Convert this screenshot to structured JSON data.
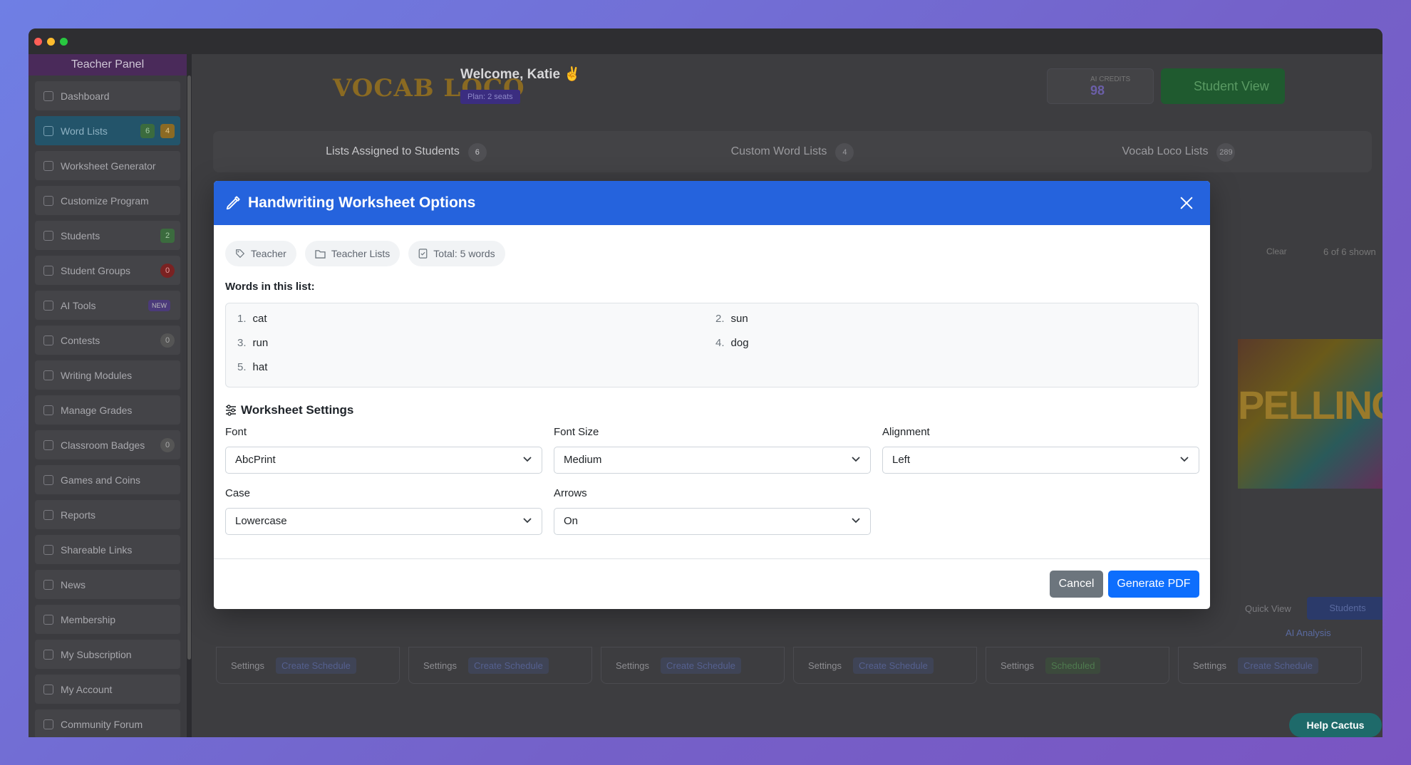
{
  "sidebar": {
    "title": "Teacher Panel",
    "items": [
      {
        "label": "Dashboard"
      },
      {
        "label": "Word Lists",
        "badges": [
          "6",
          "4"
        ]
      },
      {
        "label": "Worksheet Generator"
      },
      {
        "label": "Customize Program"
      },
      {
        "label": "Students",
        "badge": "2"
      },
      {
        "label": "Student Groups",
        "badge": "0"
      },
      {
        "label": "AI Tools",
        "badge": "NEW"
      },
      {
        "label": "Contests",
        "badge": "0"
      },
      {
        "label": "Writing Modules"
      },
      {
        "label": "Manage Grades"
      },
      {
        "label": "Classroom Badges",
        "badge": "0"
      },
      {
        "label": "Games and Coins"
      },
      {
        "label": "Reports"
      },
      {
        "label": "Shareable Links"
      },
      {
        "label": "News"
      },
      {
        "label": "Membership"
      },
      {
        "label": "My Subscription"
      },
      {
        "label": "My Account"
      },
      {
        "label": "Community Forum"
      }
    ]
  },
  "header": {
    "logo": "VOCAB LOCO",
    "welcome": "Welcome, Katie ✌",
    "plan": "Plan: 2 seats",
    "credits_label": "AI CREDITS",
    "credits_value": "98",
    "student_view": "Student View"
  },
  "tabs": [
    {
      "label": "Lists Assigned to Students",
      "count": "6"
    },
    {
      "label": "Custom Word Lists",
      "count": "4"
    },
    {
      "label": "Vocab Loco Lists",
      "count": "289"
    }
  ],
  "background": {
    "clear": "Clear",
    "shown": "6 of 6 shown",
    "card_text": "PELLING",
    "settings": "Settings",
    "create_schedule": "Create Schedule",
    "scheduled": "Scheduled",
    "quick_view": "Quick View",
    "students": "Students",
    "ai_analysis": "AI Analysis",
    "help": "Help Cactus"
  },
  "modal": {
    "title": "Handwriting Worksheet Options",
    "chips": {
      "category": "Teacher",
      "folder": "Teacher Lists",
      "total": "Total: 5 words"
    },
    "words_label": "Words in this list:",
    "words": [
      {
        "n": "1.",
        "w": "cat"
      },
      {
        "n": "2.",
        "w": "sun"
      },
      {
        "n": "3.",
        "w": "run"
      },
      {
        "n": "4.",
        "w": "dog"
      },
      {
        "n": "5.",
        "w": "hat"
      }
    ],
    "settings_title": "Worksheet Settings",
    "fields": {
      "font": {
        "label": "Font",
        "value": "AbcPrint"
      },
      "font_size": {
        "label": "Font Size",
        "value": "Medium"
      },
      "alignment": {
        "label": "Alignment",
        "value": "Left"
      },
      "case": {
        "label": "Case",
        "value": "Lowercase"
      },
      "arrows": {
        "label": "Arrows",
        "value": "On"
      }
    },
    "cancel": "Cancel",
    "generate": "Generate PDF"
  },
  "colors": {
    "modal_header": "#2563dd",
    "primary_button": "#0d6efd",
    "secondary_button": "#6c757d"
  }
}
